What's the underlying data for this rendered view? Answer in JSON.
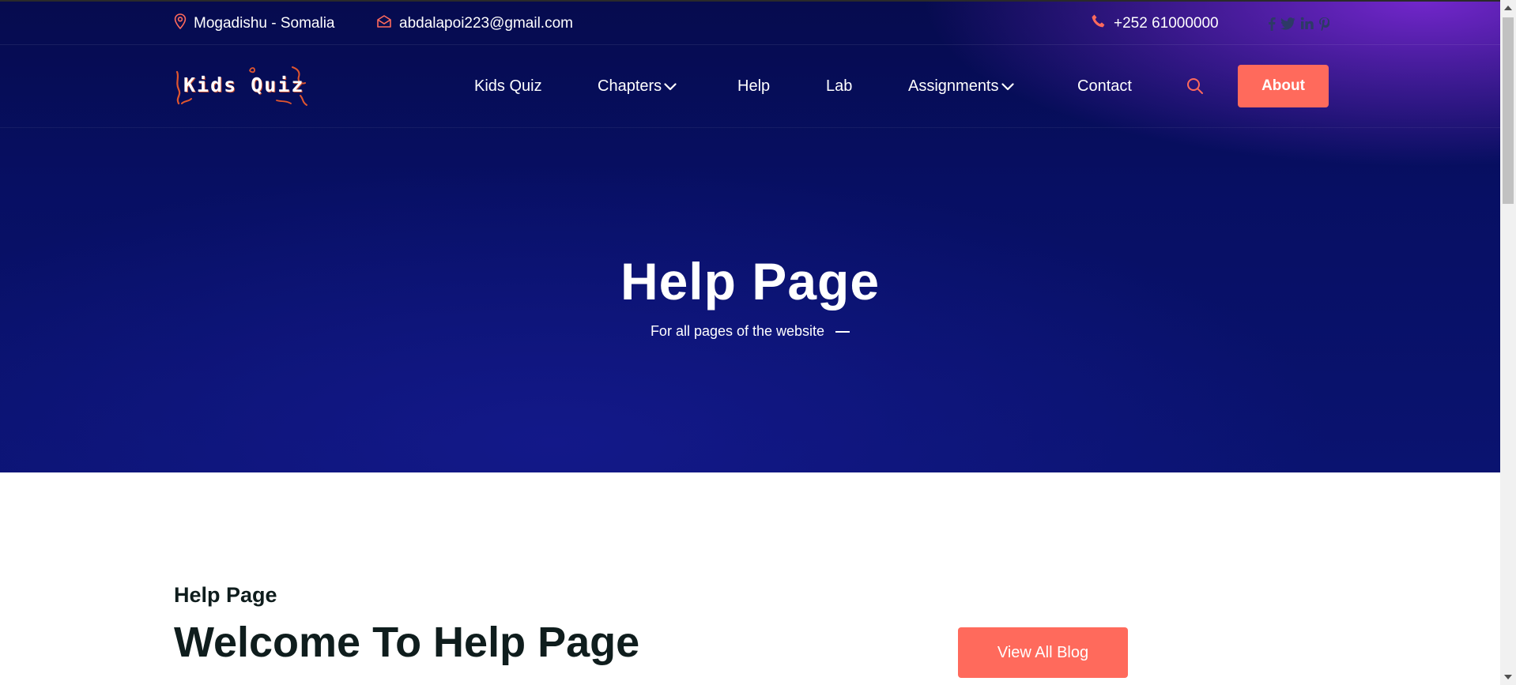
{
  "topbar": {
    "location": "Mogadishu - Somalia",
    "email": "abdalapoi223@gmail.com",
    "phone": "+252 61000000",
    "social_icons": [
      "facebook-icon",
      "twitter-icon",
      "linkedin-icon",
      "pinterest-icon"
    ]
  },
  "logo": {
    "text": "Kids Quiz"
  },
  "nav": {
    "items": [
      {
        "label": "Kids Quiz",
        "dropdown": false
      },
      {
        "label": "Chapters",
        "dropdown": true
      },
      {
        "label": "Help",
        "dropdown": false
      },
      {
        "label": "Lab",
        "dropdown": false
      },
      {
        "label": "Assignments",
        "dropdown": true
      },
      {
        "label": "Contact",
        "dropdown": false
      }
    ],
    "search_icon": "search-icon",
    "cta_label": "About"
  },
  "hero": {
    "title": "Help Page",
    "subtitle": "For all pages of the website"
  },
  "content": {
    "eyebrow": "Help Page",
    "heading": "Welcome To Help Page",
    "button_label": "View All Blog"
  },
  "colors": {
    "accent": "#ff6a5c",
    "hero_dark": "#070f63",
    "hero_purple": "#7828d2",
    "heading_text": "#0f1d1d"
  }
}
